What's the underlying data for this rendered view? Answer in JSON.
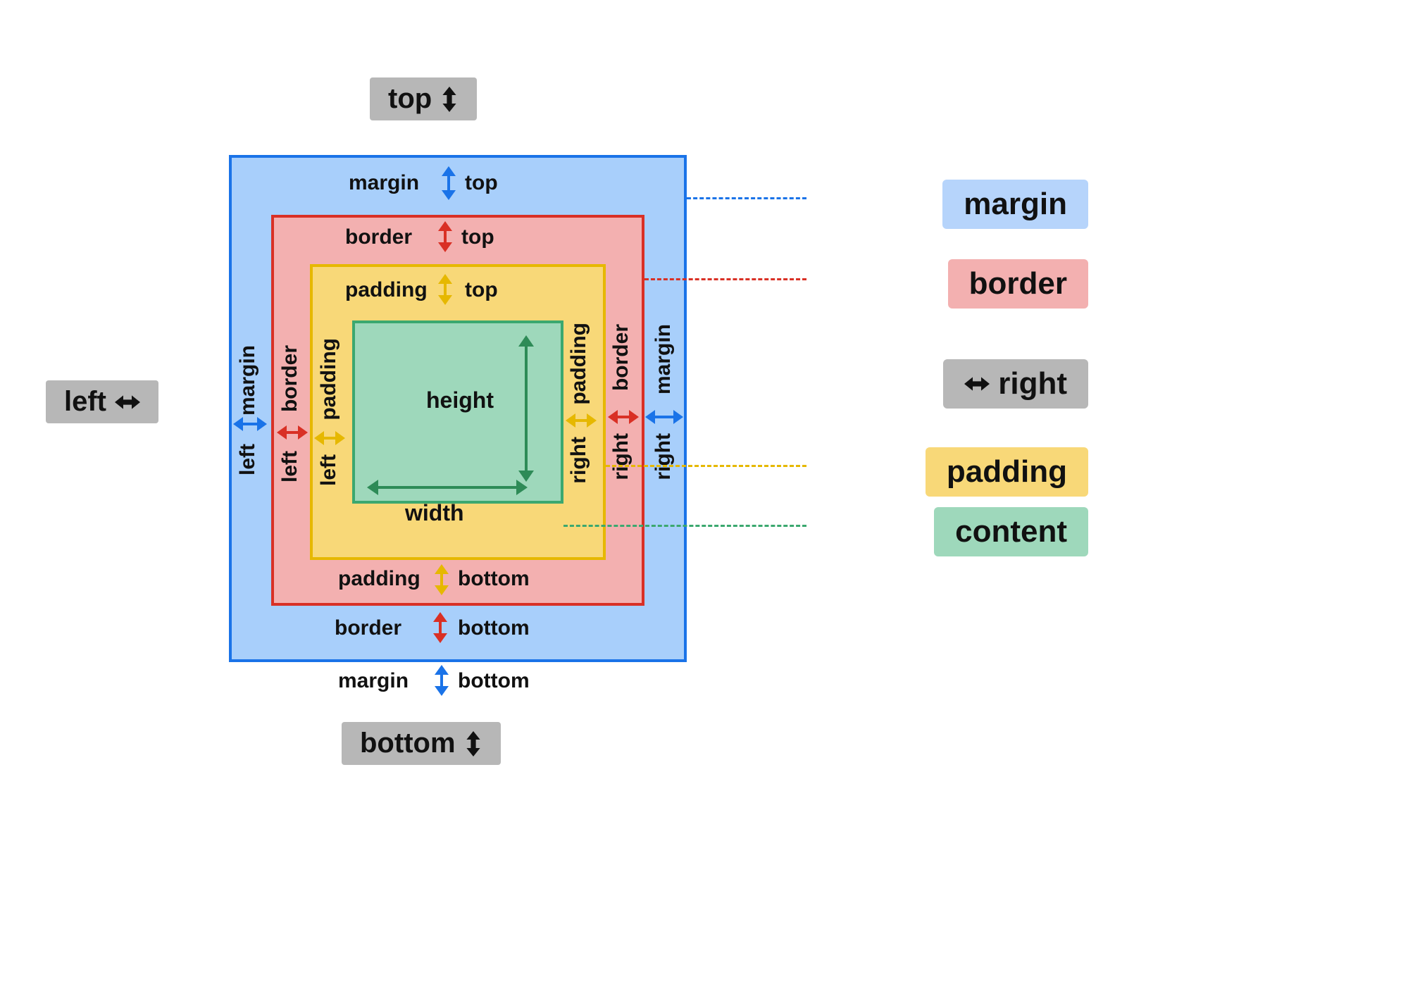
{
  "directions": {
    "top": "top",
    "bottom": "bottom",
    "left": "left",
    "right": "right"
  },
  "layers": {
    "margin": {
      "name": "margin",
      "top": "margin",
      "bottom": "margin",
      "left": "margin",
      "right": "margin"
    },
    "border": {
      "name": "border",
      "top": "border",
      "bottom": "border",
      "left": "border",
      "right": "border"
    },
    "padding": {
      "name": "padding",
      "top": "padding",
      "bottom": "padding",
      "left": "padding",
      "right": "padding"
    },
    "content": {
      "name": "content",
      "height": "height",
      "width": "width"
    }
  },
  "sides": {
    "top": "top",
    "bottom": "bottom",
    "left": "left",
    "right": "right"
  },
  "legend": {
    "margin": "margin",
    "border": "border",
    "right": "right",
    "padding": "padding",
    "content": "content"
  },
  "colors": {
    "margin_fill": "#a8cffb",
    "margin_stroke": "#1a73e8",
    "border_fill": "#f3b0b0",
    "border_stroke": "#d93025",
    "padding_fill": "#f8d878",
    "padding_stroke": "#e6b800",
    "content_fill": "#9ed8bb",
    "content_stroke": "#3ba86f",
    "grey": "#b7b7b7"
  }
}
